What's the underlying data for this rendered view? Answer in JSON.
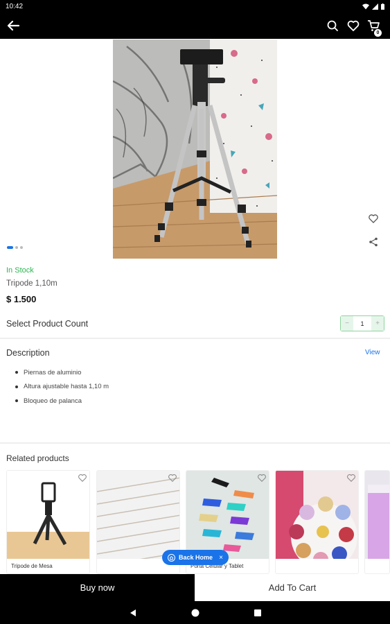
{
  "status_bar": {
    "time": "10:42"
  },
  "app_bar": {
    "cart_count": "0"
  },
  "product": {
    "stock": "In Stock",
    "name": "Tripode 1,10m",
    "price": "$ 1.500",
    "image_count": 3,
    "active_image": 1
  },
  "quantity": {
    "label": "Select Product Count",
    "value": "1",
    "minus": "−",
    "plus": "+"
  },
  "description": {
    "title": "Description",
    "view_label": "View",
    "bullets": [
      "Piernas de aluminio",
      "Altura ajustable hasta 1,10 m",
      "Bloqueo de palanca"
    ]
  },
  "related": {
    "title": "Related products",
    "items": [
      {
        "name": "Tripode de Mesa"
      },
      {
        "name": ""
      },
      {
        "name": "Porta Celular y Tablet"
      },
      {
        "name": ""
      },
      {
        "name": ""
      }
    ]
  },
  "back_home": {
    "label": "Back Home",
    "close": "×"
  },
  "actions": {
    "buy_now": "Buy now",
    "add_to_cart": "Add To Cart"
  },
  "colors": {
    "accent": "#1a73e8",
    "in_stock": "#2db552",
    "bar": "#000000"
  }
}
